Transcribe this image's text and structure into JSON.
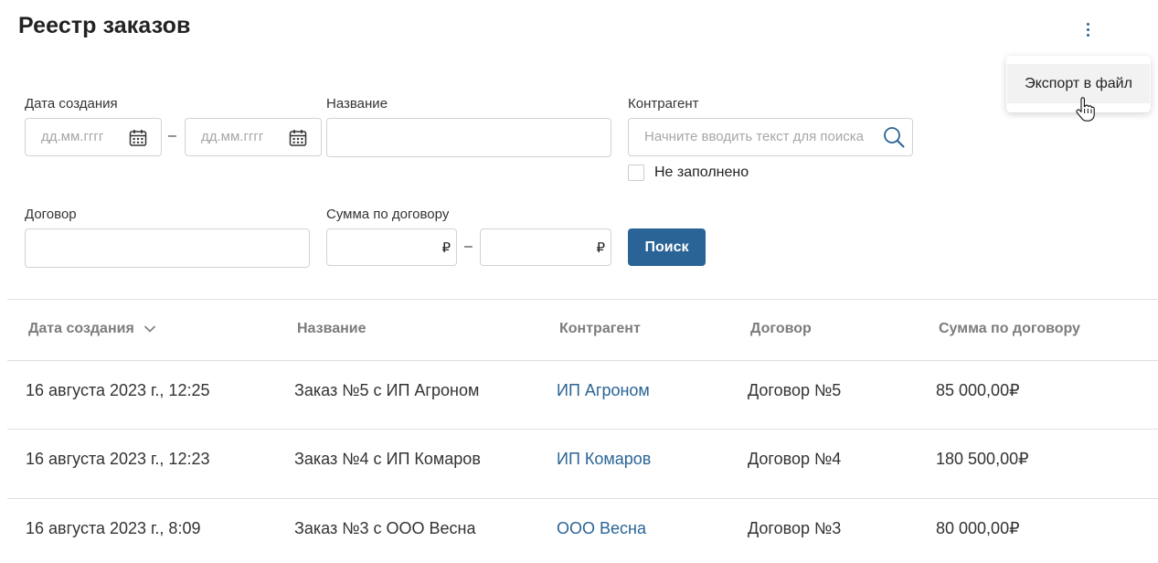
{
  "page": {
    "title": "Реестр заказов"
  },
  "menu": {
    "export_label": "Экспорт в файл"
  },
  "filters": {
    "date_label": "Дата создания",
    "date_from_placeholder": "дд.мм.гггг",
    "date_to_placeholder": "дд.мм.гггг",
    "date_range_dash": "–",
    "name_label": "Название",
    "name_value": "",
    "counterparty_label": "Контрагент",
    "counterparty_placeholder": "Начните вводить текст для поиска",
    "empty_checkbox_label": "Не заполнено",
    "contract_label": "Договор",
    "contract_value": "",
    "sum_label": "Сумма по договору",
    "currency": "₽",
    "sum_range_dash": "–",
    "search_button": "Поиск"
  },
  "table": {
    "columns": [
      "Дата создания",
      "Название",
      "Контрагент",
      "Договор",
      "Сумма по договору"
    ],
    "rows": [
      {
        "date": "16 августа 2023 г., 12:25",
        "name": "Заказ №5 с ИП Агроном",
        "counterparty": "ИП Агроном",
        "contract": "Договор №5",
        "sum": "85 000,00₽"
      },
      {
        "date": "16 августа 2023 г., 12:23",
        "name": "Заказ №4 с ИП Комаров",
        "counterparty": "ИП Комаров",
        "contract": "Договор №4",
        "sum": "180 500,00₽"
      },
      {
        "date": "16 августа 2023 г., 8:09",
        "name": "Заказ №3 с ООО Весна",
        "counterparty": "ООО Весна",
        "contract": "Договор №3",
        "sum": "80 000,00₽"
      }
    ]
  },
  "colors": {
    "accent": "#2a6496",
    "header_text": "#7c7c7c",
    "border": "#cfd3d7"
  },
  "icons": [
    "more-vertical-icon",
    "calendar-icon",
    "search-icon",
    "chevron-down-icon",
    "hand-pointer-icon"
  ]
}
